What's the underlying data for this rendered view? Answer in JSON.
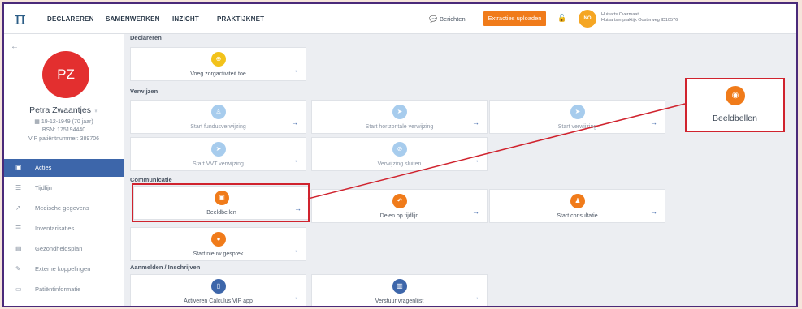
{
  "topbar": {
    "logo": "π",
    "nav": [
      "DECLAREREN",
      "SAMENWERKEN",
      "INZICHT",
      "PRAKTIJKNET"
    ],
    "messages": "Berichten",
    "upload_button": "Extracties uploaden",
    "user_initials": "NO",
    "user_line1": "Huisarts Overmaat",
    "user_line2": "Huisartsenpraktijk Oosterweg ID10576"
  },
  "patient": {
    "initials": "PZ",
    "name": "Petra Zwaantjes",
    "gender_symbol": "♀",
    "dob": "19-12-1949 (70 jaar)",
    "bsn": "BSN: 175194440",
    "vip": "VIP patiëntnummer: 389706"
  },
  "sidebar": {
    "items": [
      {
        "label": "Acties",
        "icon": "calendar-icon"
      },
      {
        "label": "Tijdlijn",
        "icon": "list-icon"
      },
      {
        "label": "Medische gegevens",
        "icon": "chart-icon"
      },
      {
        "label": "Inventarisaties",
        "icon": "list-icon"
      },
      {
        "label": "Gezondheidsplan",
        "icon": "document-icon"
      },
      {
        "label": "Externe koppelingen",
        "icon": "edit-icon"
      },
      {
        "label": "Patiëntinformatie",
        "icon": "id-card-icon"
      }
    ]
  },
  "sections": {
    "declareren": "Declareren",
    "verwijzen": "Verwijzen",
    "communicatie": "Communicatie",
    "aanmelden": "Aanmelden / Inschrijven"
  },
  "cards": {
    "zorgactiviteit": "Voeg zorgactiviteit toe",
    "fundus": "Start fundusverwijzing",
    "horizontale": "Start horizontale verwijzing",
    "verwijzing": "Start verwijzing",
    "vvt": "Start VVT verwijzing",
    "sluiten": "Verwijzing sluiten",
    "beeldbellen": "Beeldbellen",
    "delen": "Delen op tijdlijn",
    "consultatie": "Start consultatie",
    "gesprek": "Start nieuw gesprek",
    "vip_app": "Activeren Calculus VIP app",
    "vragenlijst": "Verstuur vragenlijst"
  },
  "callout": {
    "label": "Beeldbellen"
  },
  "colors": {
    "accent_blue": "#3d66aa",
    "orange": "#f07b1a",
    "highlight_red": "#d0232e",
    "avatar_red": "#e32f2f"
  }
}
